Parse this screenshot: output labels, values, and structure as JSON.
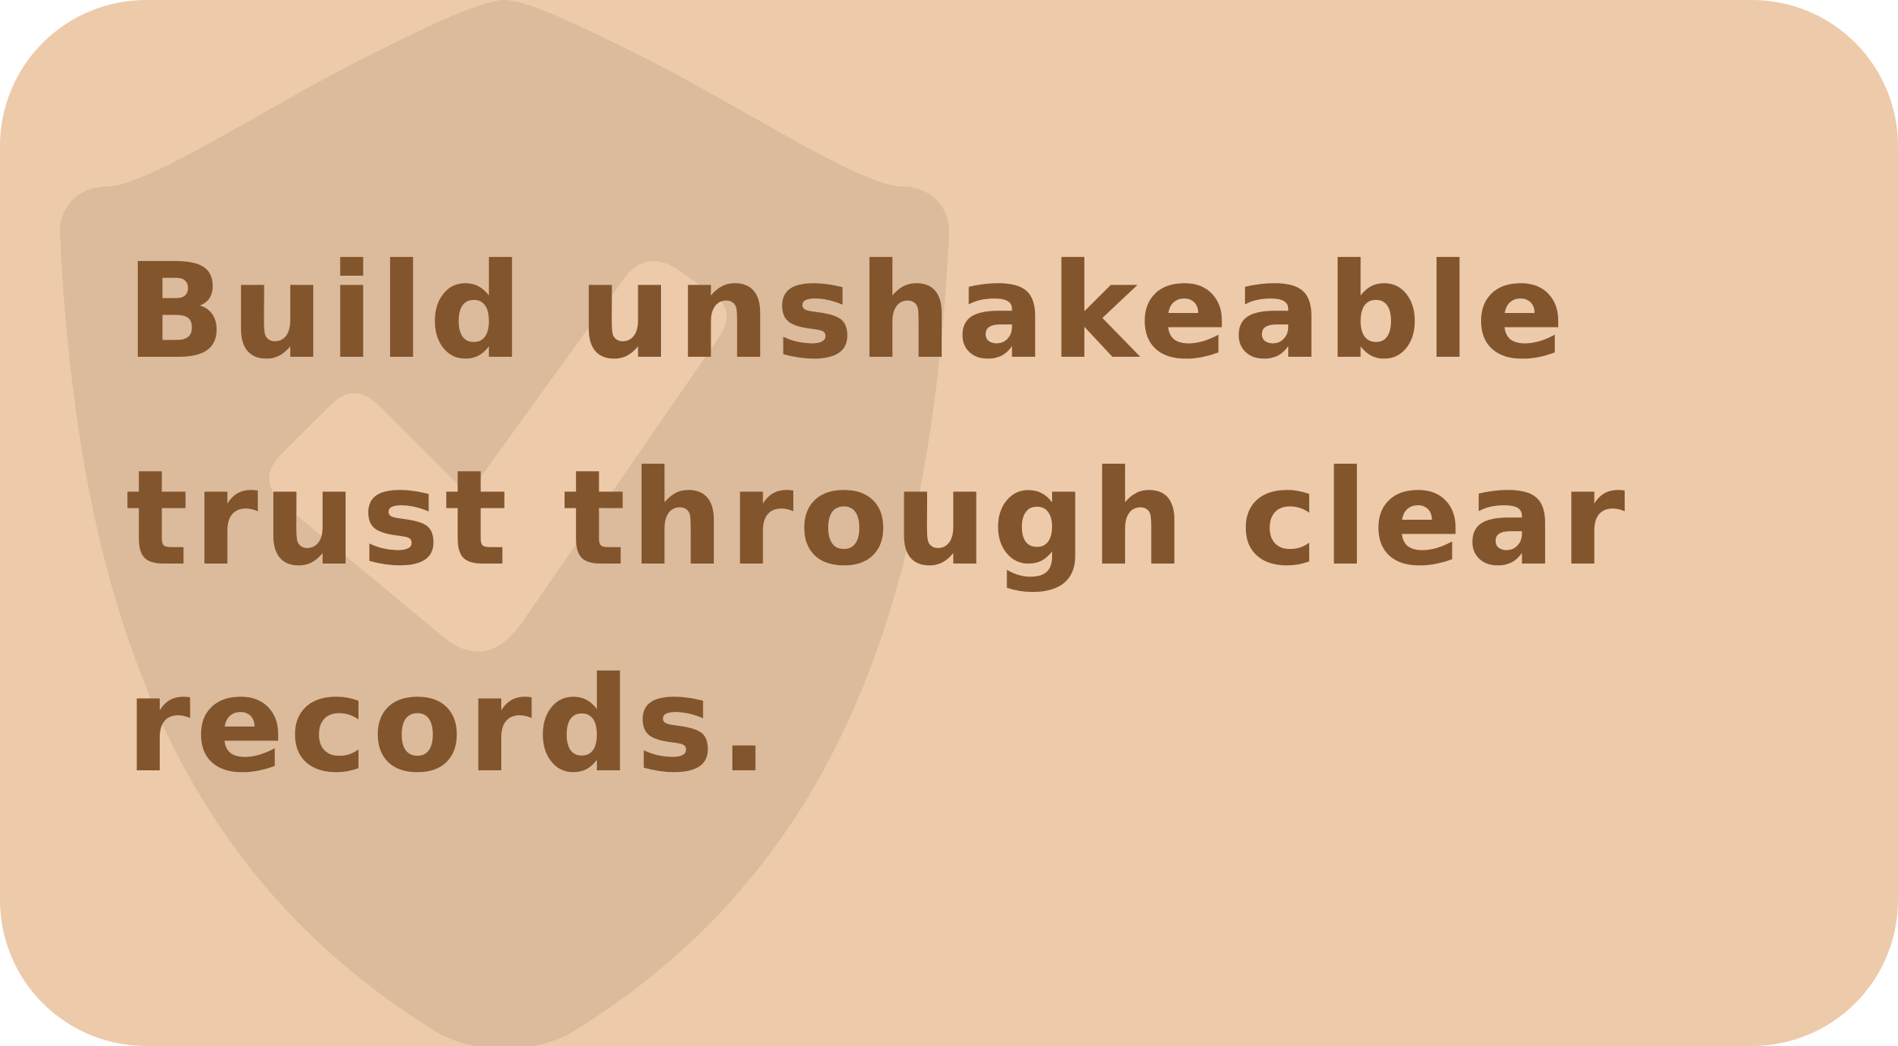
{
  "card": {
    "background_color": "#EDCAAA",
    "text_color": "#82552D",
    "icon_color": "#DBBB9C",
    "headline": "Build unshakeable trust through clear records.",
    "background_icon": "shield-check-icon"
  }
}
